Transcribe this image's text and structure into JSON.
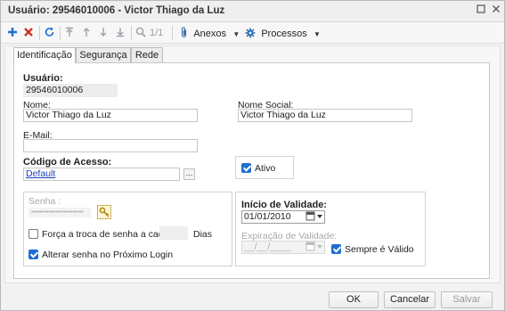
{
  "window": {
    "title": "Usuário: 29546010006 - Victor Thiago da Luz"
  },
  "toolbar": {
    "page_indicator": "1/1",
    "anexos_label": "Anexos",
    "processos_label": "Processos"
  },
  "tabs": [
    {
      "label": "Identificação",
      "active": true
    },
    {
      "label": "Segurança",
      "active": false
    },
    {
      "label": "Rede",
      "active": false
    }
  ],
  "form": {
    "usuario_label": "Usuário:",
    "usuario_value": "29546010006",
    "nome_label": "Nome:",
    "nome_value": "Victor Thiago da Luz",
    "nome_social_label": "Nome Social:",
    "nome_social_value": "Victor Thiago da Luz",
    "email_label": "E-Mail:",
    "email_value": "",
    "codigo_acesso_label": "Código de Acesso:",
    "codigo_acesso_value": "Default",
    "lookup_label": "...",
    "ativo_label": "Ativo",
    "ativo_checked": true
  },
  "senha": {
    "label": "Senha :",
    "value": "••••••••••••••••••••••••",
    "forca_troca_label": "Força a troca de senha a cada",
    "forca_troca_checked": false,
    "dias_value": "",
    "dias_label": "Dias",
    "alterar_label": "Alterar senha no Próximo Login",
    "alterar_checked": true
  },
  "validade": {
    "inicio_label": "Início de Validade:",
    "inicio_value": "01/01/2010",
    "expiracao_label": "Expiração de Validade:",
    "expiracao_value": "__/__/____",
    "sempre_label": "Sempre é Válido",
    "sempre_checked": true
  },
  "footer": {
    "ok_label": "OK",
    "cancelar_label": "Cancelar",
    "salvar_label": "Salvar"
  },
  "colors": {
    "accent_blue": "#1f6fd1",
    "delete_red": "#d0302b",
    "link_blue": "#1a3fbf"
  }
}
